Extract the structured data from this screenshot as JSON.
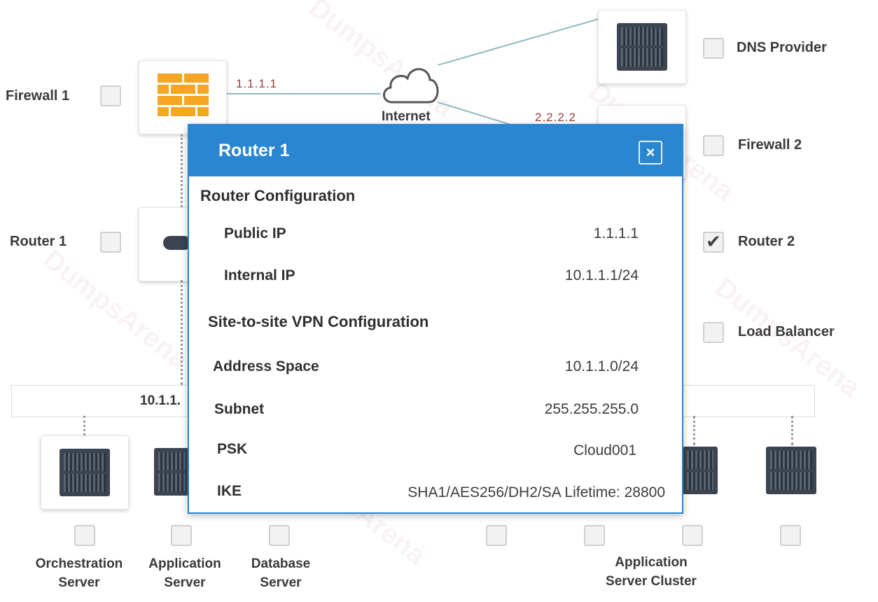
{
  "nodes": {
    "firewall1": {
      "label": "Firewall 1",
      "ip": "1.1.1.1"
    },
    "internet": {
      "label": "Internet"
    },
    "dns": {
      "label": "DNS Provider"
    },
    "firewall2": {
      "label": "Firewall 2",
      "ip": "2.2.2.2"
    },
    "router1": {
      "label": "Router 1"
    },
    "router2": {
      "label": "Router 2",
      "checked": true
    },
    "load_balancer": {
      "label": "Load Balancer"
    },
    "network_left": {
      "label": "10.1.1."
    },
    "orchestration": {
      "line1": "Orchestration",
      "line2": "Server"
    },
    "application": {
      "line1": "Application",
      "line2": "Server"
    },
    "database": {
      "line1": "Database",
      "line2": "Server"
    },
    "app_cluster": {
      "line1": "Application",
      "line2": "Server Cluster"
    }
  },
  "modal": {
    "title": "Router 1",
    "close_symbol": "×",
    "router_config_heading": "Router Configuration",
    "public_ip_label": "Public IP",
    "public_ip_value": "1.1.1.1",
    "internal_ip_label": "Internal IP",
    "internal_ip_value": "10.1.1.1/24",
    "vpn_heading": "Site-to-site VPN Configuration",
    "address_space_label": "Address Space",
    "address_space_value": "10.1.1.0/24",
    "subnet_label": "Subnet",
    "subnet_value": "255.255.255.0",
    "psk_label": "PSK",
    "psk_value": "Cloud001",
    "ike_label": "IKE",
    "ike_value": "SHA1/AES256/DH2/SA Lifetime: 28800"
  },
  "watermark": "DumpsArena",
  "check_mark": "✔",
  "colors": {
    "modal_header": "#2a86d1",
    "ip_text": "#9b3d3a",
    "firewall_orange": "#f5a623"
  }
}
